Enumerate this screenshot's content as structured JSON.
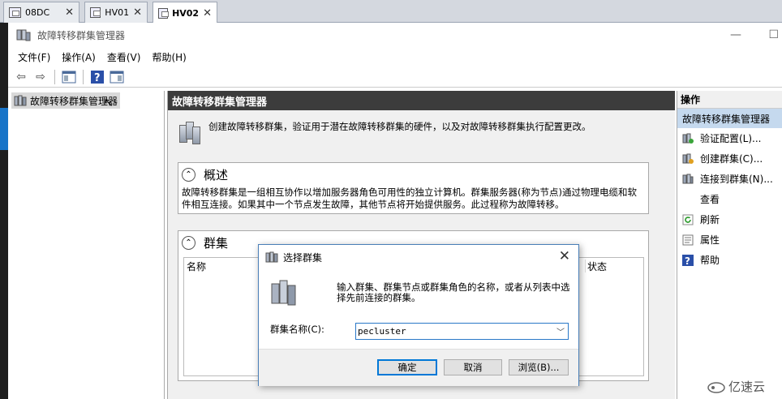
{
  "tabs": [
    {
      "label": "08DC"
    },
    {
      "label": "HV01"
    },
    {
      "label": "HV02",
      "active": true
    }
  ],
  "window": {
    "title": "故障转移群集管理器",
    "minimize": "—",
    "maximize": "☐"
  },
  "menu": [
    "文件(F)",
    "操作(A)",
    "查看(V)",
    "帮助(H)"
  ],
  "tree": {
    "root": "故障转移群集管理器"
  },
  "center": {
    "header": "故障转移群集管理器",
    "intro": "创建故障转移群集，验证用于潜在故障转移群集的硬件，以及对故障转移群集执行配置更改。",
    "overview": {
      "title": "概述",
      "text": "故障转移群集是一组相互协作以增加服务器角色可用性的独立计算机。群集服务器(称为节点)通过物理电缆和软件相互连接。如果其中一个节点发生故障，其他节点将开始提供服务。此过程称为故障转移。"
    },
    "clusters": {
      "title": "群集",
      "col_name": "名称",
      "col_status": "状态"
    }
  },
  "actions": {
    "header": "操作",
    "group": "故障转移群集管理器",
    "items": [
      "验证配置(L)...",
      "创建群集(C)...",
      "连接到群集(N)...",
      "查看",
      "刷新",
      "属性",
      "帮助"
    ]
  },
  "dialog": {
    "title": "选择群集",
    "message": "输入群集、群集节点或群集角色的名称，或者从列表中选择先前连接的群集。",
    "label": "群集名称(C):",
    "value": "pecluster",
    "ok": "确定",
    "cancel": "取消",
    "browse": "浏览(B)..."
  },
  "watermark": "亿速云",
  "colors": {
    "header_bg": "#3c3c3c",
    "action_group_bg": "#c5d9ee",
    "focus_blue": "#0078d7"
  }
}
